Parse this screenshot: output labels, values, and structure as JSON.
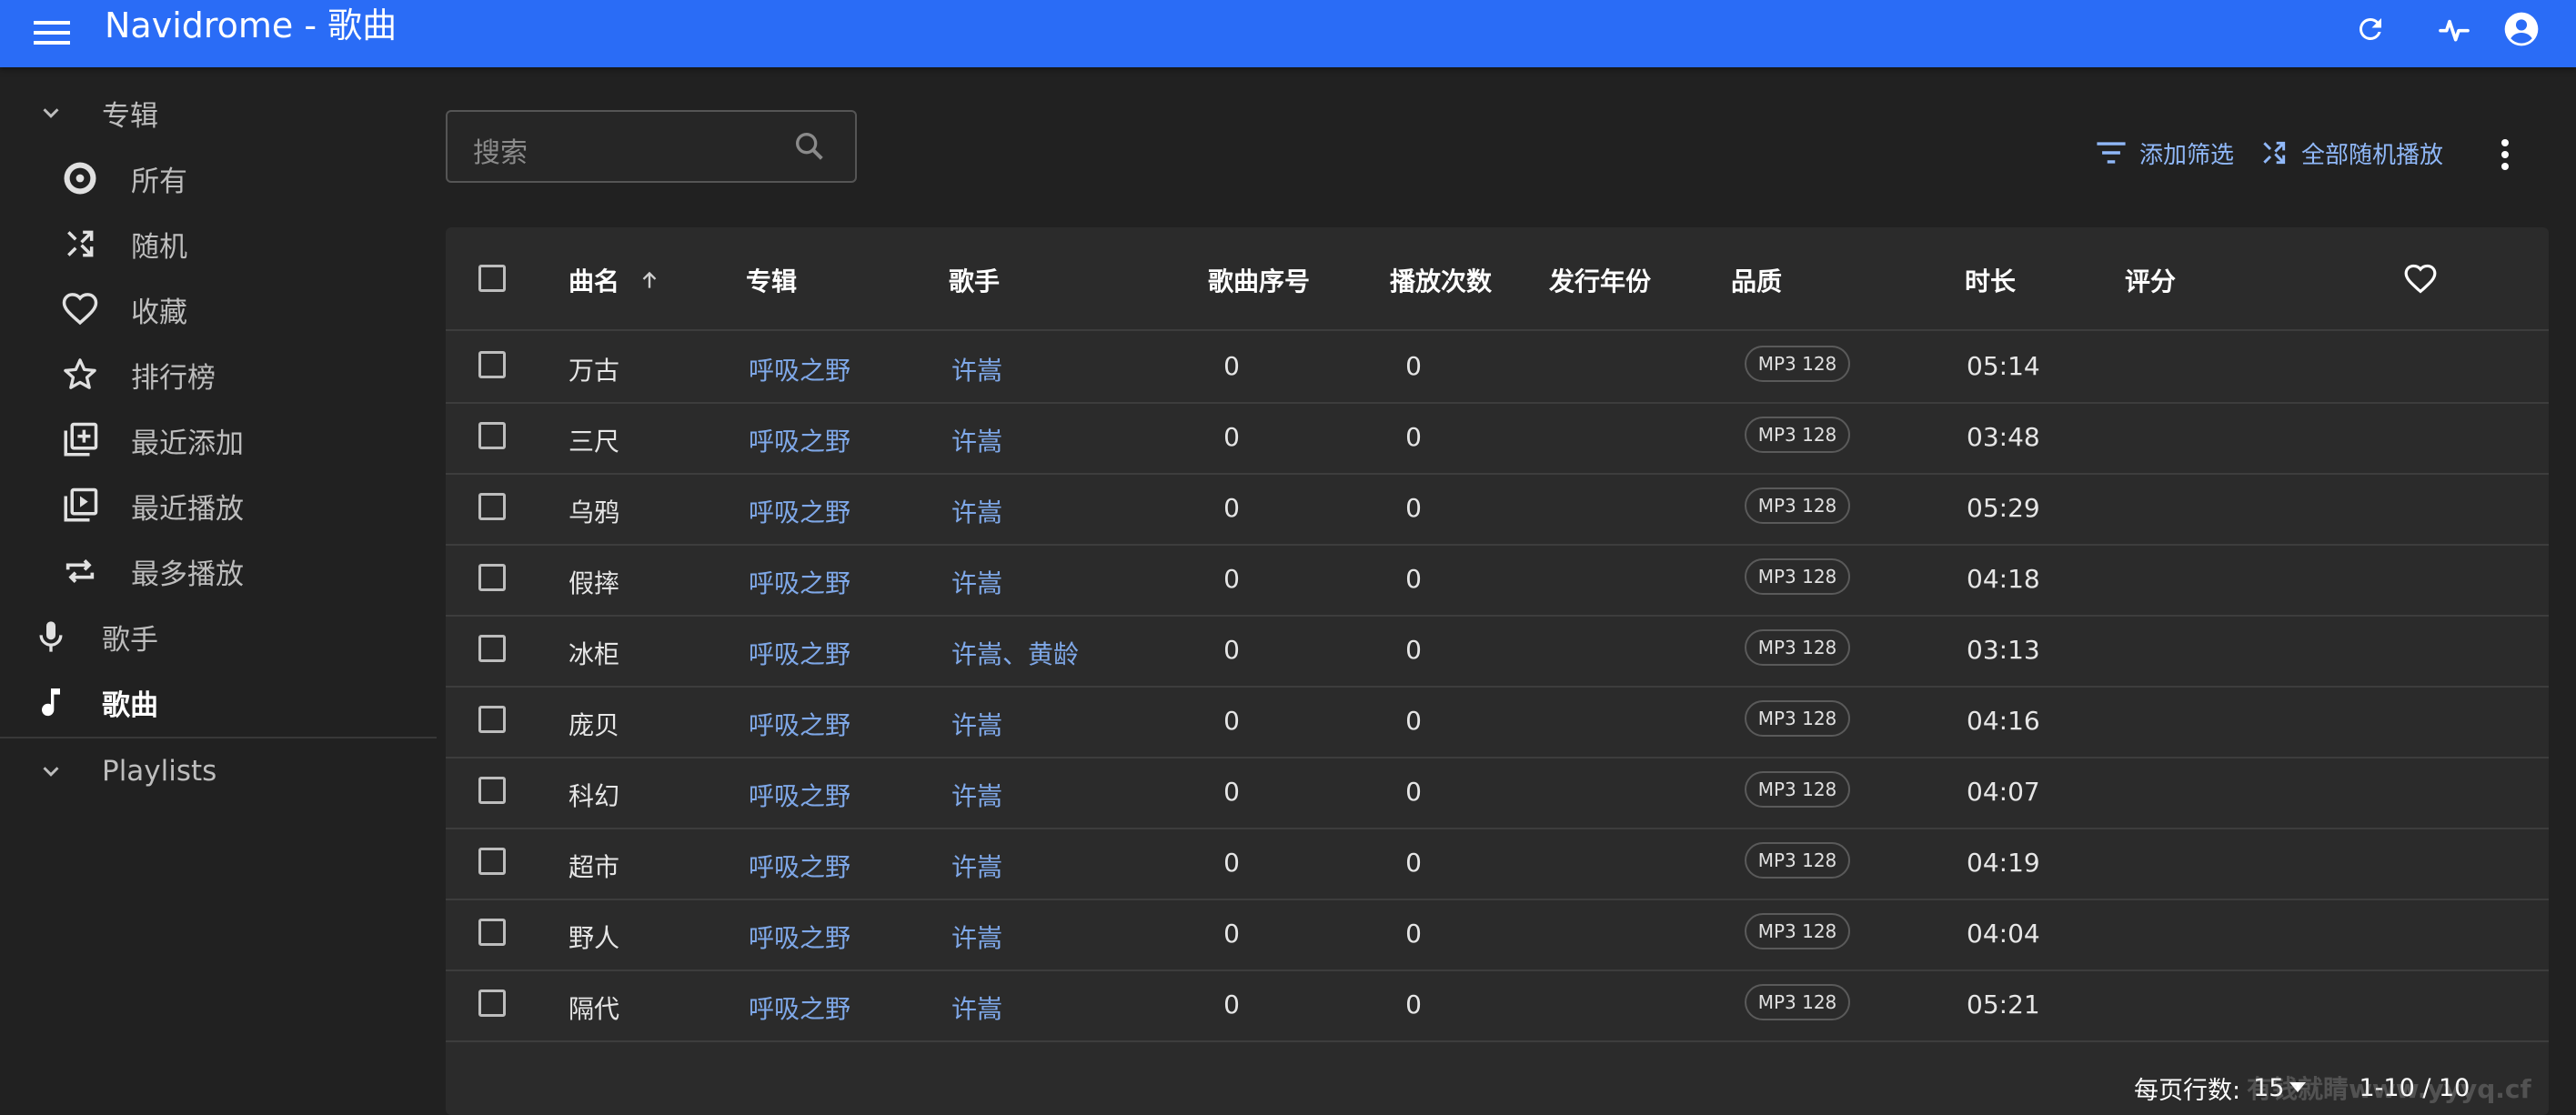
{
  "app": {
    "title": "Navidrome - 歌曲"
  },
  "sidebar": {
    "albums_label": "专辑",
    "album_items": [
      {
        "label": "所有",
        "icon": "album-disc-icon"
      },
      {
        "label": "随机",
        "icon": "shuffle-icon"
      },
      {
        "label": "收藏",
        "icon": "heart-icon"
      },
      {
        "label": "排行榜",
        "icon": "star-icon"
      },
      {
        "label": "最近添加",
        "icon": "library-add-icon"
      },
      {
        "label": "最近播放",
        "icon": "video-library-icon"
      },
      {
        "label": "最多播放",
        "icon": "repeat-icon"
      }
    ],
    "artists_label": "歌手",
    "songs_label": "歌曲",
    "playlists_label": "Playlists"
  },
  "search": {
    "placeholder": "搜索"
  },
  "toolbar": {
    "add_filter": "添加筛选",
    "shuffle_all": "全部随机播放"
  },
  "table": {
    "headers": [
      "曲名",
      "专辑",
      "歌手",
      "歌曲序号",
      "播放次数",
      "发行年份",
      "品质",
      "时长",
      "评分"
    ],
    "sort": "曲名 ascending",
    "rows": [
      {
        "title": "万古",
        "album": "呼吸之野",
        "artist": "许嵩",
        "track": "0",
        "plays": "0",
        "quality": "MP3 128",
        "duration": "05:14"
      },
      {
        "title": "三尺",
        "album": "呼吸之野",
        "artist": "许嵩",
        "track": "0",
        "plays": "0",
        "quality": "MP3 128",
        "duration": "03:48"
      },
      {
        "title": "乌鸦",
        "album": "呼吸之野",
        "artist": "许嵩",
        "track": "0",
        "plays": "0",
        "quality": "MP3 128",
        "duration": "05:29"
      },
      {
        "title": "假摔",
        "album": "呼吸之野",
        "artist": "许嵩",
        "track": "0",
        "plays": "0",
        "quality": "MP3 128",
        "duration": "04:18"
      },
      {
        "title": "冰柜",
        "album": "呼吸之野",
        "artist": "许嵩、黄龄",
        "track": "0",
        "plays": "0",
        "quality": "MP3 128",
        "duration": "03:13"
      },
      {
        "title": "庞贝",
        "album": "呼吸之野",
        "artist": "许嵩",
        "track": "0",
        "plays": "0",
        "quality": "MP3 128",
        "duration": "04:16"
      },
      {
        "title": "科幻",
        "album": "呼吸之野",
        "artist": "许嵩",
        "track": "0",
        "plays": "0",
        "quality": "MP3 128",
        "duration": "04:07"
      },
      {
        "title": "超市",
        "album": "呼吸之野",
        "artist": "许嵩",
        "track": "0",
        "plays": "0",
        "quality": "MP3 128",
        "duration": "04:19"
      },
      {
        "title": "野人",
        "album": "呼吸之野",
        "artist": "许嵩",
        "track": "0",
        "plays": "0",
        "quality": "MP3 128",
        "duration": "04:04"
      },
      {
        "title": "隔代",
        "album": "呼吸之野",
        "artist": "许嵩",
        "track": "0",
        "plays": "0",
        "quality": "MP3 128",
        "duration": "05:21"
      }
    ]
  },
  "pagination": {
    "rows_per_page_label": "每页行数:",
    "rows_per_page": "15",
    "range": "1-10 / 10"
  },
  "watermark": "有钱就睛www.yyyq.cf",
  "colors": {
    "appbar": "#2a6cf6",
    "background": "#212121",
    "card": "#2b2b2b",
    "link": "#7fa8e8"
  }
}
